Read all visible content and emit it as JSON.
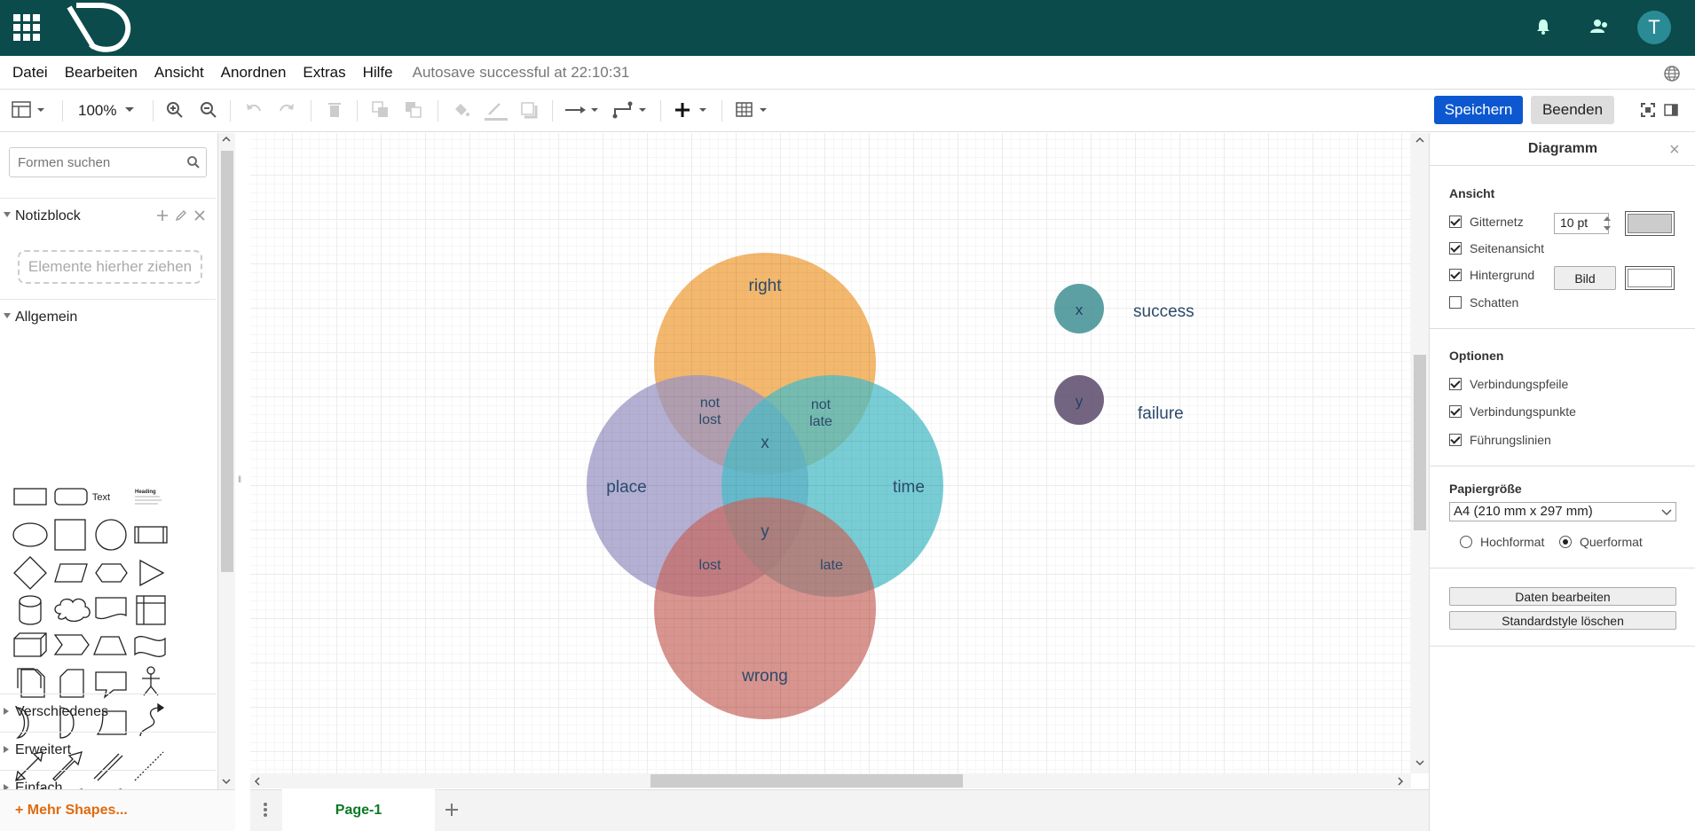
{
  "topbar": {
    "avatar_letter": "T",
    "colors": {
      "bar": "#0b4b4b",
      "avatar": "#2b8b95"
    }
  },
  "menu": {
    "items": [
      "Datei",
      "Bearbeiten",
      "Ansicht",
      "Anordnen",
      "Extras",
      "Hilfe"
    ],
    "autosave": "Autosave successful at 22:10:31"
  },
  "toolbar": {
    "zoom": "100%",
    "save_label": "Speichern",
    "end_label": "Beenden"
  },
  "sidebar": {
    "search_placeholder": "Formen suchen",
    "scratchpad_label": "Notizblock",
    "drop_hint": "Elemente hierher ziehen",
    "general_label": "Allgemein",
    "shape_text_label": "Text",
    "shape_heading_label": "Heading",
    "sections": [
      "Verschiedenes",
      "Erweitert",
      "Einfach"
    ],
    "more_shapes": "+ Mehr Shapes..."
  },
  "canvas": {
    "circles": {
      "right": "right",
      "place": "place",
      "time": "time",
      "wrong": "wrong"
    },
    "intersections": {
      "not_lost_1": "not",
      "not_lost_2": "lost",
      "not_late_1": "not",
      "not_late_2": "late",
      "x": "x",
      "y": "y",
      "lost": "lost",
      "late": "late"
    },
    "legend": [
      {
        "key": "x",
        "label": "success",
        "color": "#3f8f94"
      },
      {
        "key": "y",
        "label": "failure",
        "color": "#5b4a6b"
      }
    ],
    "colors": {
      "right": "#f0a64a",
      "place": "#9a95c4",
      "time": "#4bbcc7",
      "wrong": "#c7675e"
    }
  },
  "pages": {
    "tab": "Page-1"
  },
  "panel": {
    "title": "Diagramm",
    "view_heading": "Ansicht",
    "grid_label": "Gitternetz",
    "grid_size": "10 pt",
    "page_view_label": "Seitenansicht",
    "background_label": "Hintergrund",
    "image_button": "Bild",
    "shadow_label": "Schatten",
    "options_heading": "Optionen",
    "connection_arrows": "Verbindungspfeile",
    "connection_points": "Verbindungspunkte",
    "guides": "Führungslinien",
    "paper_heading": "Papiergröße",
    "paper_size": "A4 (210 mm x 297 mm)",
    "portrait": "Hochformat",
    "landscape": "Querformat",
    "edit_data": "Daten bearbeiten",
    "clear_style": "Standardstyle löschen"
  }
}
